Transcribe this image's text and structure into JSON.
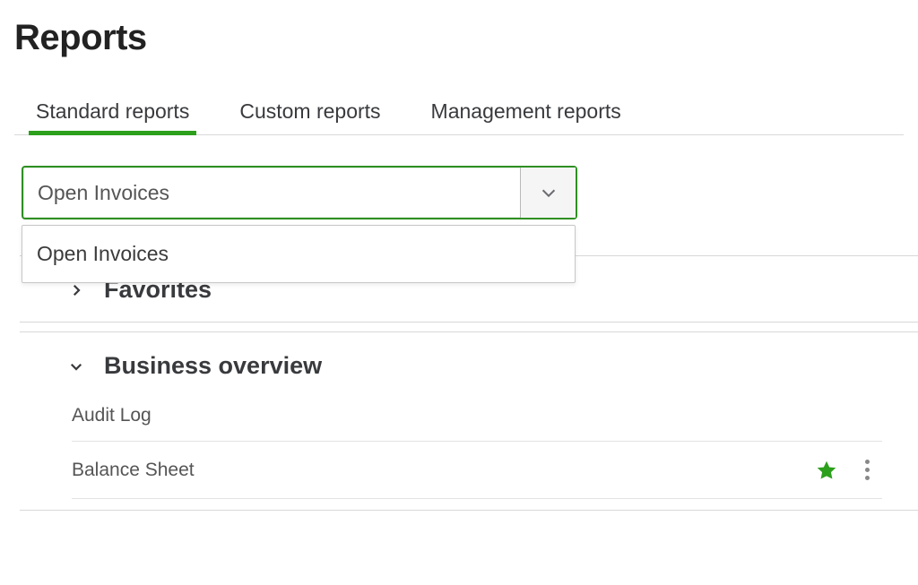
{
  "page_title": "Reports",
  "tabs": {
    "standard": "Standard reports",
    "custom": "Custom reports",
    "management": "Management reports",
    "active": "standard"
  },
  "search_combo": {
    "value": "Open Invoices",
    "dropdown_items": [
      "Open Invoices"
    ]
  },
  "sections": {
    "favorites": {
      "label": "Favorites",
      "expanded": false
    },
    "business_overview": {
      "label": "Business overview",
      "expanded": true,
      "reports": [
        {
          "name": "Audit Log",
          "starred": false
        },
        {
          "name": "Balance Sheet",
          "starred": true
        }
      ]
    }
  },
  "colors": {
    "accent": "#2ca01c",
    "combo_border": "#2f8f23",
    "border": "#d8d8d8",
    "text": "#393a3d",
    "muted_text": "#555555"
  }
}
